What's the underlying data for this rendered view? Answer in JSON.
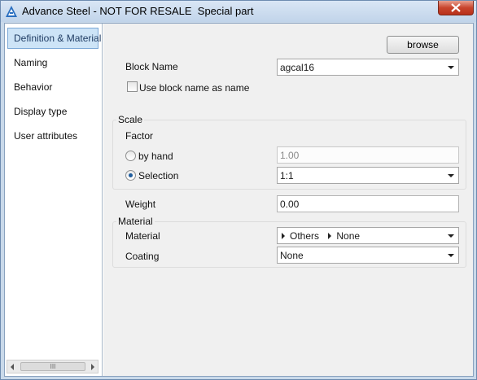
{
  "window": {
    "title": "Advance Steel - NOT FOR RESALE  Special part"
  },
  "sidebar": {
    "items": [
      {
        "label": "Definition & Material"
      },
      {
        "label": "Naming"
      },
      {
        "label": "Behavior"
      },
      {
        "label": "Display type"
      },
      {
        "label": "User attributes"
      }
    ],
    "selected": "Definition & Material",
    "scroll_thumb": "III"
  },
  "form": {
    "browse_label": "browse",
    "block_name_label": "Block Name",
    "block_name_value": "agcal16",
    "use_block_name_label": "Use block name as name",
    "use_block_name_checked": false,
    "scale": {
      "title": "Scale",
      "factor_label": "Factor",
      "by_hand_label": "by hand",
      "by_hand_value": "1.00",
      "selection_label": "Selection",
      "selection_value": "1:1",
      "selected_option": "Selection"
    },
    "weight_label": "Weight",
    "weight_value": "0.00",
    "material": {
      "title": "Material",
      "material_label": "Material",
      "material_path": [
        "Others",
        "None"
      ],
      "coating_label": "Coating",
      "coating_value": "None"
    }
  },
  "colors": {
    "selected_item_bg": "#cde4f7",
    "title_bar": "#c9d9ea",
    "close_button": "#c8452d",
    "radio_dot": "#1f5d9e"
  }
}
